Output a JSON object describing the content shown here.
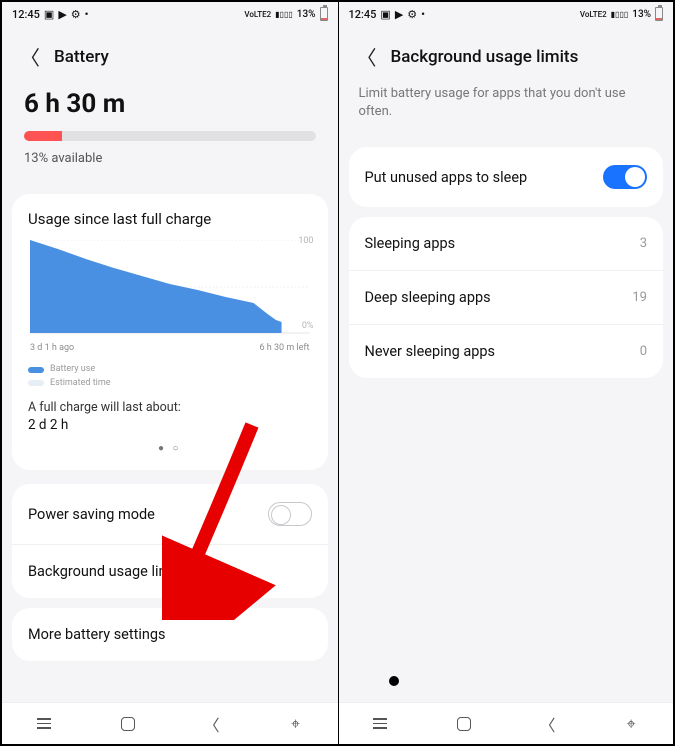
{
  "status": {
    "time": "12:45",
    "network_label": "VoLTE2",
    "battery_pct": "13%"
  },
  "left": {
    "title": "Battery",
    "hero_time": "6 h 30 m",
    "progress_pct": 13,
    "available_text": "13% available",
    "usage_title": "Usage since last full charge",
    "x_start": "3 d 1 h ago",
    "x_end": "6 h 30 m left",
    "legend_use": "Battery use",
    "legend_est": "Estimated time",
    "full_charge_label": "A full charge will last about:",
    "full_charge_value": "2 d 2 h",
    "power_saving": "Power saving mode",
    "bg_limits": "Background usage limits",
    "more_settings": "More battery settings"
  },
  "right": {
    "title": "Background usage limits",
    "subtitle": "Limit battery usage for apps that you don't use often.",
    "put_sleep": "Put unused apps to sleep",
    "rows": [
      {
        "label": "Sleeping apps",
        "count": "3"
      },
      {
        "label": "Deep sleeping apps",
        "count": "19"
      },
      {
        "label": "Never sleeping apps",
        "count": "0"
      }
    ]
  },
  "chart_data": {
    "type": "area",
    "title": "Usage since last full charge",
    "xlabel": "",
    "ylabel": "",
    "ylim": [
      0,
      100
    ],
    "x_range_labels": [
      "3 d 1 h ago",
      "6 h 30 m left"
    ],
    "series": [
      {
        "name": "Battery use",
        "color": "#4a90e2",
        "x": [
          0.0,
          0.1,
          0.2,
          0.3,
          0.4,
          0.5,
          0.6,
          0.7,
          0.8,
          0.85,
          0.88,
          0.9
        ],
        "values": [
          100,
          90,
          80,
          70,
          62,
          54,
          47,
          40,
          33,
          22,
          15,
          13
        ]
      },
      {
        "name": "Estimated time",
        "color": "#e8eef6",
        "x": [
          0.9,
          1.0
        ],
        "values": [
          13,
          0
        ]
      }
    ]
  }
}
